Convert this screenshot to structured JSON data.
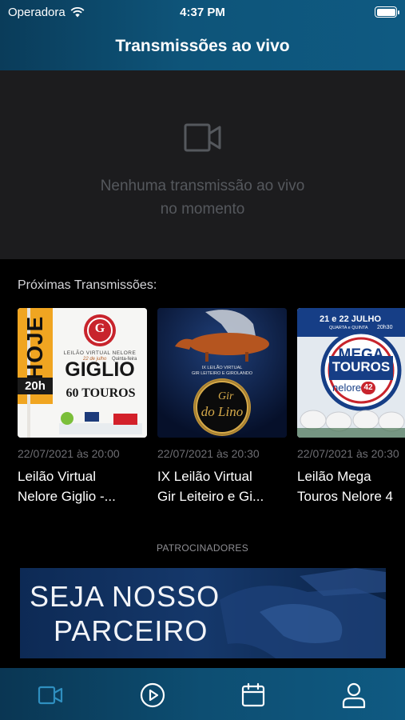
{
  "status_bar": {
    "carrier": "Operadora",
    "time": "4:37 PM"
  },
  "header": {
    "title": "Transmissões ao vivo"
  },
  "live": {
    "empty_line1": "Nenhuma transmissão ao vivo",
    "empty_line2": "no momento"
  },
  "upcoming": {
    "label": "Próximas Transmissões:",
    "items": [
      {
        "date": "22/07/2021 às 20:00",
        "title_line1": "Leilão Virtual",
        "title_line2": "Nelore Giglio -...",
        "thumb": {
          "badge": "HOJE",
          "badge_time": "20h",
          "logo": "G",
          "small_heading": "LEILÃO VIRTUAL NELORE",
          "main": "GIGLIO",
          "date": "22 de julho",
          "weekday": "Quinta-feira",
          "count": "60 TOUROS"
        }
      },
      {
        "date": "22/07/2021 às 20:30",
        "title_line1": "IX Leilão Virtual",
        "title_line2": "Gir Leiteiro e Gi...",
        "thumb": {
          "caption1": "IX LEILÃO VIRTUAL",
          "caption2": "GIR LEITEIRO E GIROLANDO",
          "seal_l1": "Gir",
          "seal_l2": "do Lino"
        }
      },
      {
        "date": "22/07/2021 às 20:30",
        "title_line1": "Leilão Mega",
        "title_line2": "Touros Nelore 4",
        "thumb": {
          "dates": "21 e 22 JULHO",
          "weekdays": "QUARTA e QUINTA",
          "hour": "20h30",
          "mega": "MEGA",
          "touros": "TOUROS",
          "nelore": "nelore",
          "num": "42"
        }
      }
    ]
  },
  "sponsors": {
    "label": "PATROCINADORES",
    "banner_line1": "SEJA NOSSO",
    "banner_line2": "PARCEIRO"
  },
  "tabbar": {
    "active_color": "#2f8fc0",
    "inactive_color": "#ffffff",
    "tabs": [
      {
        "icon": "video-camera-icon",
        "active": true
      },
      {
        "icon": "play-circle-icon",
        "active": false
      },
      {
        "icon": "calendar-icon",
        "active": false
      },
      {
        "icon": "user-icon",
        "active": false
      }
    ]
  }
}
